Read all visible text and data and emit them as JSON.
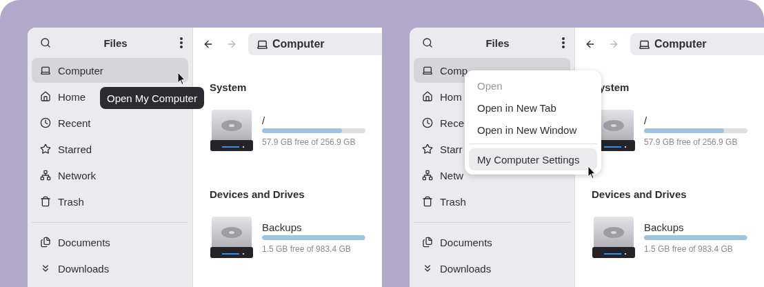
{
  "windows": [
    {
      "title": "Files",
      "sidebar": [
        {
          "label": "Computer",
          "selected": true
        },
        {
          "label": "Home",
          "selected": false
        },
        {
          "label": "Recent",
          "selected": false
        },
        {
          "label": "Starred",
          "selected": false
        },
        {
          "label": "Network",
          "selected": false
        },
        {
          "label": "Trash",
          "selected": false
        }
      ],
      "places": [
        {
          "label": "Documents",
          "selected": false
        },
        {
          "label": "Downloads",
          "selected": false
        }
      ],
      "back": {
        "disabled": false
      },
      "forward": {
        "disabled": true
      },
      "location": "Computer",
      "sections": [
        {
          "title": "System",
          "cut_left": false,
          "drives": [
            {
              "name": "/",
              "level": 0.77,
              "free": "57.9 GB free of 256.9 GB"
            }
          ]
        },
        {
          "title": "Devices and Drives",
          "cut_left": false,
          "drives": [
            {
              "name": "Backups",
              "level": 0.99,
              "free": "1.5 GB free of 983.4 GB"
            }
          ]
        }
      ],
      "overlay": {
        "kind": "tooltip",
        "text": "Open My Computer"
      }
    },
    {
      "title": "Files",
      "sidebar": [
        {
          "label": "Comp",
          "selected": true
        },
        {
          "label": "Hom",
          "selected": false
        },
        {
          "label": "Rece",
          "selected": false
        },
        {
          "label": "Starr",
          "selected": false
        },
        {
          "label": "Netw",
          "selected": false
        },
        {
          "label": "Trash",
          "selected": false
        }
      ],
      "places": [
        {
          "label": "Documents",
          "selected": false
        },
        {
          "label": "Downloads",
          "selected": false
        }
      ],
      "back": {
        "disabled": false
      },
      "forward": {
        "disabled": true
      },
      "location": "Computer",
      "sections": [
        {
          "title": "ystem",
          "cut_left": true,
          "drives": [
            {
              "name": "/",
              "level": 0.77,
              "free": "57.9 GB free of 256.9 GB"
            }
          ]
        },
        {
          "title": "Devices and Drives",
          "cut_left": false,
          "drives": [
            {
              "name": "Backups",
              "level": 0.99,
              "free": "1.5 GB free of 983.4 GB"
            }
          ]
        }
      ],
      "overlay": {
        "kind": "menu",
        "items": [
          {
            "label": "Open",
            "disabled": true,
            "selected": false
          },
          {
            "label": "Open in New Tab",
            "disabled": false,
            "selected": false
          },
          {
            "label": "Open in New Window",
            "disabled": false,
            "selected": false
          },
          {
            "label": "My Computer Settings",
            "disabled": false,
            "selected": true,
            "separator_before": true
          }
        ]
      }
    }
  ]
}
